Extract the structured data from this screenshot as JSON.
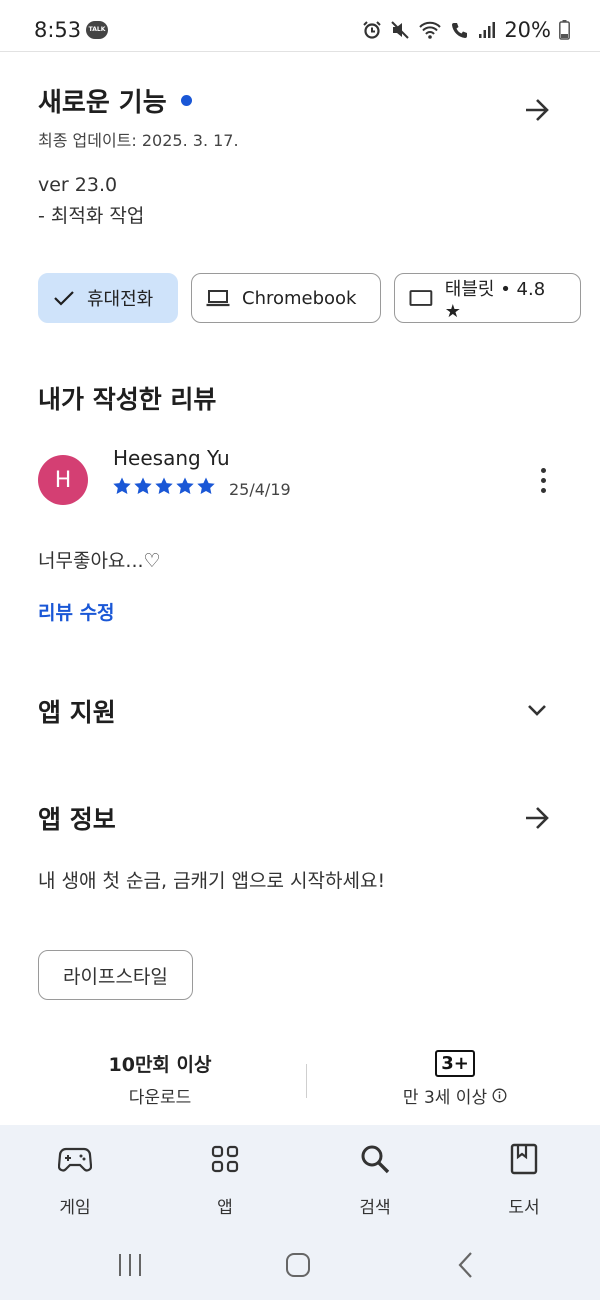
{
  "status_bar": {
    "time": "8:53",
    "talk_badge": "TALK",
    "battery": "20%"
  },
  "whats_new": {
    "title": "새로운 기능",
    "updated": "최종 업데이트: 2025. 3. 17.",
    "version": "ver 23.0",
    "note": "- 최적화 작업"
  },
  "device_chips": [
    {
      "label": "휴대전화",
      "icon": "check-icon",
      "selected": true
    },
    {
      "label": "Chromebook",
      "icon": "laptop-icon",
      "selected": false
    },
    {
      "label": "태블릿 • 4.8 ★",
      "icon": "tablet-icon",
      "selected": false
    }
  ],
  "my_review": {
    "heading": "내가 작성한 리뷰",
    "avatar_letter": "H",
    "reviewer": "Heesang Yu",
    "stars": 5,
    "date": "25/4/19",
    "text": "너무좋아요...♡",
    "edit_label": "리뷰 수정"
  },
  "app_support": {
    "heading": "앱 지원"
  },
  "app_info": {
    "heading": "앱 정보",
    "description": "내 생애 첫 순금, 금캐기 앱으로 시작하세요!",
    "tag": "라이프스타일"
  },
  "stats": {
    "downloads_value": "10만회 이상",
    "downloads_label": "다운로드",
    "rating_badge": "3+",
    "rating_label": "만 3세 이상"
  },
  "bottom_nav": [
    {
      "label": "게임",
      "icon": "gamepad-icon"
    },
    {
      "label": "앱",
      "icon": "apps-grid-icon"
    },
    {
      "label": "검색",
      "icon": "search-icon"
    },
    {
      "label": "도서",
      "icon": "book-icon"
    }
  ],
  "colors": {
    "accent": "#1a57d6",
    "chip_selected": "#cfe3fa",
    "avatar": "#d43f73",
    "nav_bg": "#eef2f8"
  }
}
